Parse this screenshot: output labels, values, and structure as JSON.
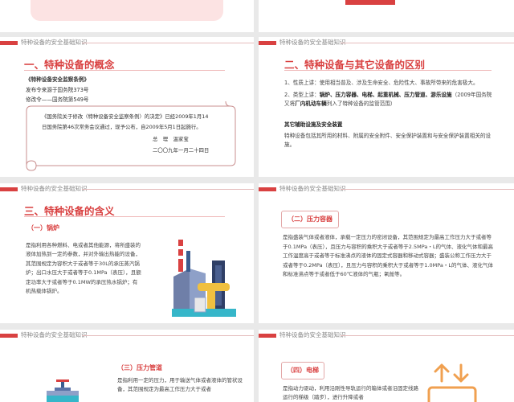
{
  "header_text": "特种设备的安全基础知识",
  "slide2": {
    "title": "一、特种设备的概念",
    "regulation": "《特种设备安全监察条例》",
    "line1": "发布令来源于国务院373号",
    "line2": "修改令——国务院第549号",
    "scroll_p1": "《国务院关于修改〈特种设备安全监察条例〉的决定》已经2009年1月14",
    "scroll_p2": "日国务院第46次常务会议通过，现予公布，自2009年5月1日起施行。",
    "sign_role": "总　理　温家宝",
    "sign_date": "二〇〇九年一月二十四日"
  },
  "slide3": {
    "title": "二、特种设备与其它设备的区别",
    "p1": "1、性质上讲：使用相当普及、涉及生命安全、危险性大、事故所带来的危害极大。",
    "p2_pre": "2、类型上讲：",
    "p2_bold": "锅炉、压力容器、电梯、起重机械、压力管道、游乐设施",
    "p2_mid": "（2009年国务院又将",
    "p2_bold2": "厂内机动车辆",
    "p2_post": "列入了特种设备的监管范围）",
    "subtitle": "其它辅助设施及安全装置",
    "p3": "特种设备包括其所用的材料、附属的安全附件、安全保护装置和与安全保护装置相关的设施。"
  },
  "slide4": {
    "title": "三、特种设备的含义",
    "sub": "（一）锅炉",
    "body": "是指利用各种燃料、电或者其他能源，将所盛装的液体加热到一定的参数，并对外输出热能的设备，其范围规定为容积大于或者等于30L的承压蒸汽锅炉；出口水压大于或者等于0.1MPa（表压），且额定功率大于或者等于0.1MW的承压热水锅炉；有机热载体锅炉。"
  },
  "slide5": {
    "sub": "（二）压力容器",
    "body": "是指盛装气体或者液体，承载一定压力的密闭设备，其范围规定为最高工作压力大于或者等于0.1MPa（表压），且压力与容积的乘积大于或者等于2.5MPa・L的气体、液化气体和最高工作温度高于或者等于标准沸点的液体的固定式容器和移动式容器；盛装公称工作压力大于或者等于0.2MPa（表压），且压力与容积的乘积大于或者等于1.0MPa・L的气体、液化气体和标准沸点等于或者低于60℃液体的气瓶；氧舱等。"
  },
  "slide6": {
    "sub": "（三）压力管道",
    "body": "是指利用一定的压力，用于输送气体或者液体的管状设备，其范围规定为最高工作压力大于或者"
  },
  "slide7": {
    "sub": "（四）电梯",
    "body": "是指动力驱动，利用沿刚性导轨运行的箱体或者沿固定线路运行的梯级（踏步），进行升降或者"
  }
}
